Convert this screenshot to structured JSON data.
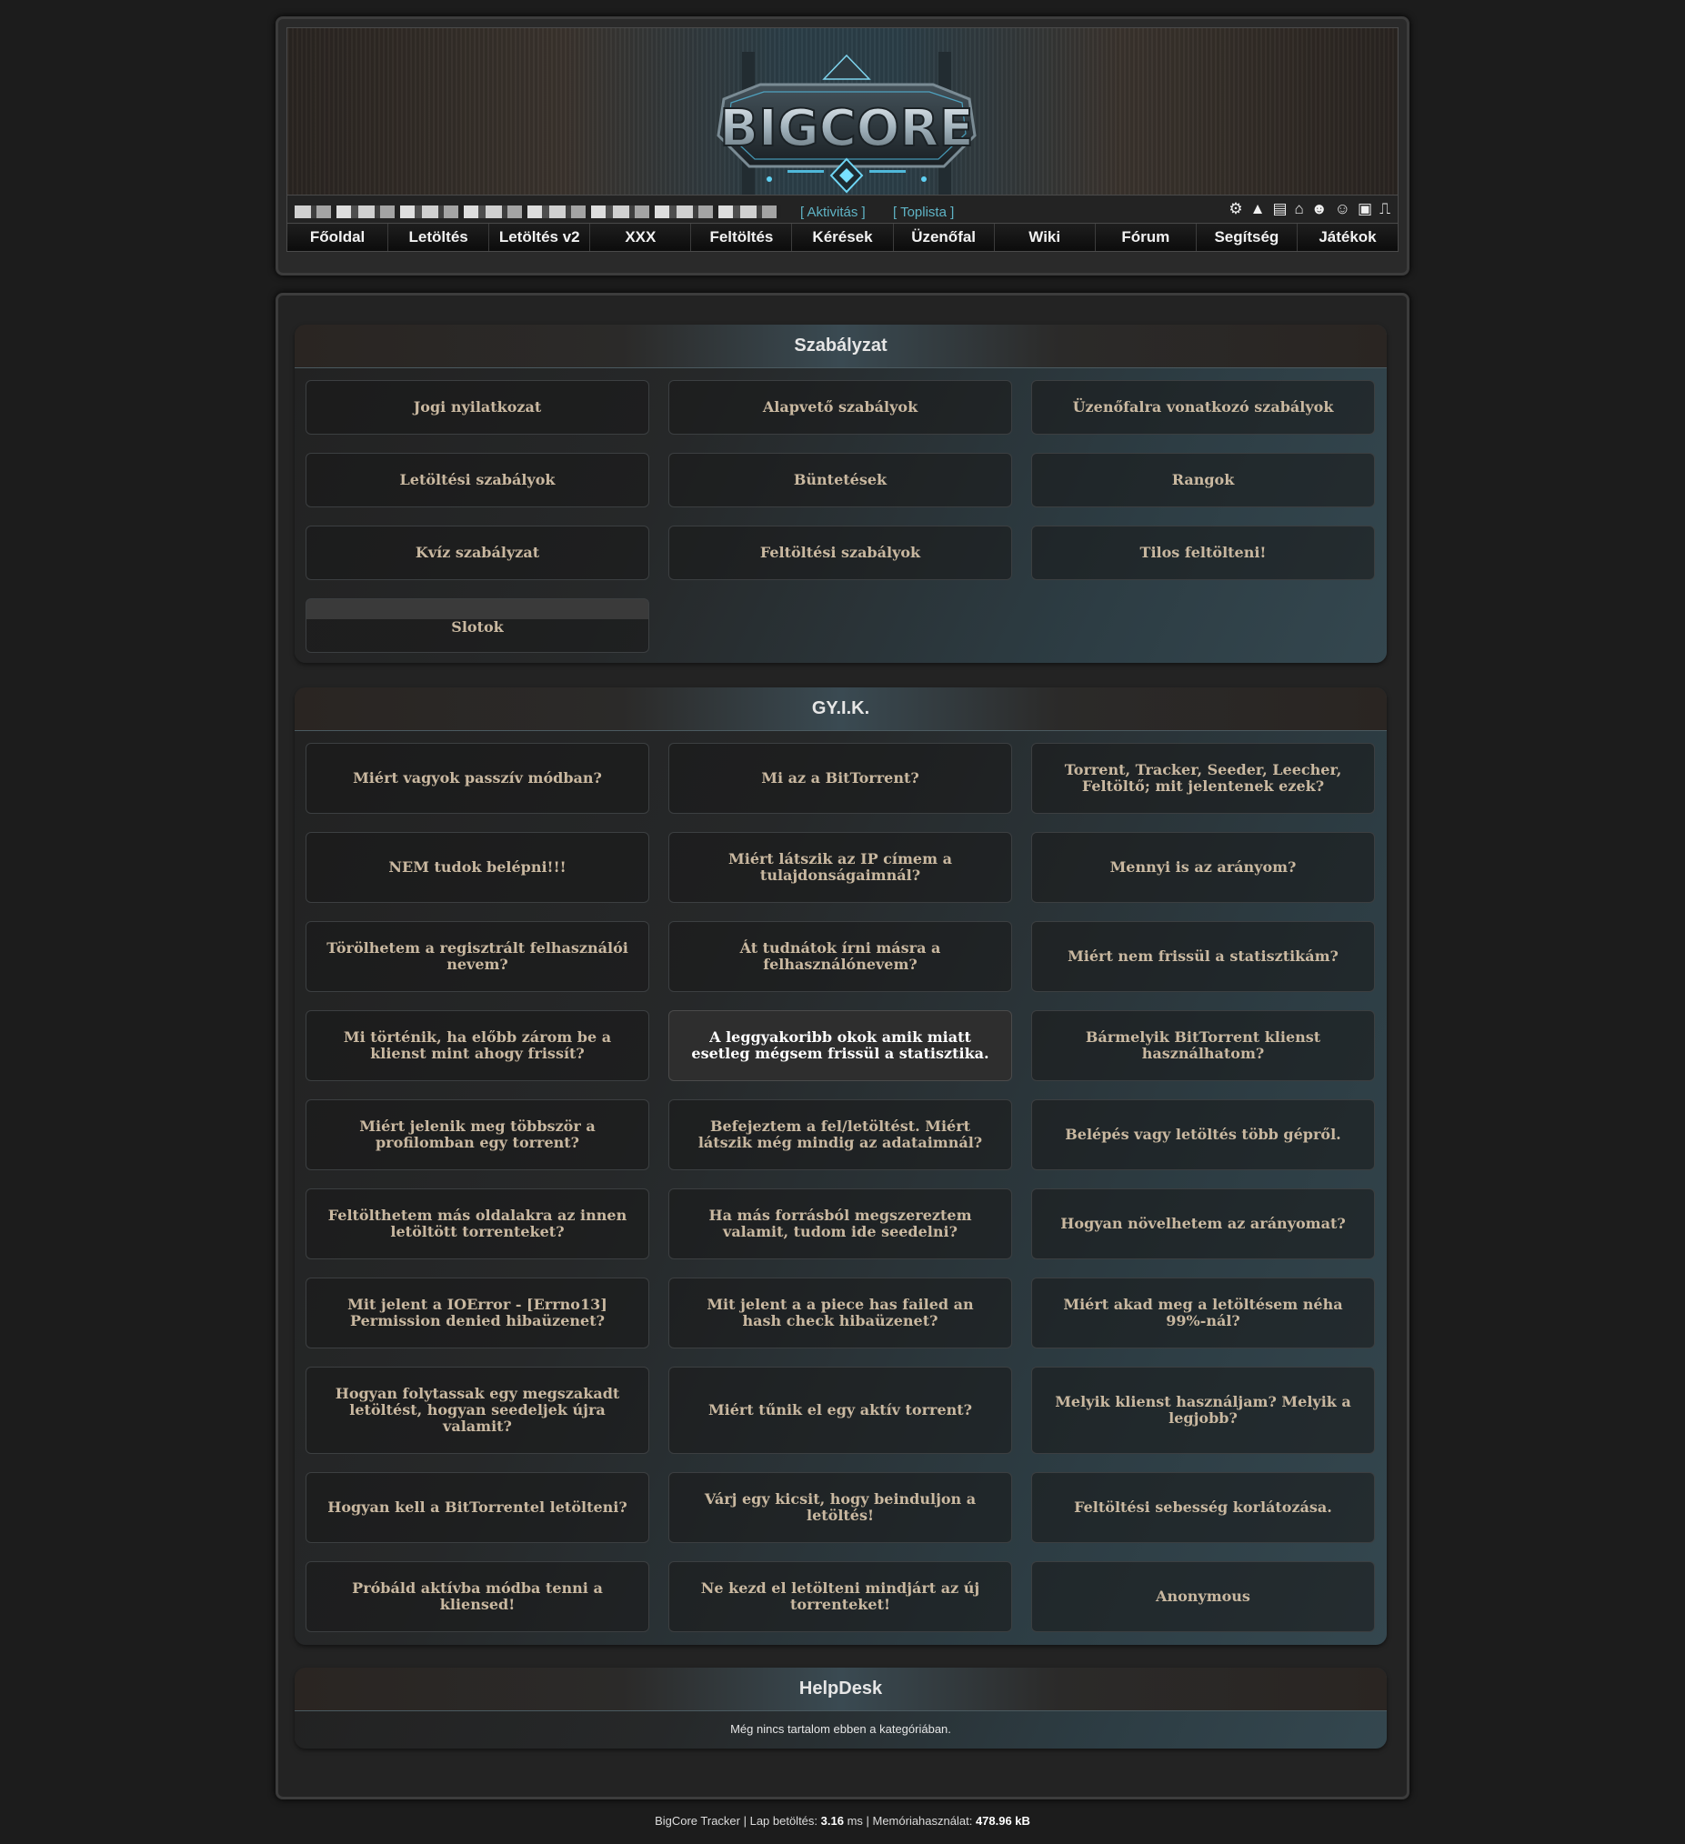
{
  "brand": {
    "logo_text": "BIGCORE"
  },
  "userbar": {
    "links": [
      "[ Aktivitás ]",
      "[ Toplista ]"
    ],
    "icons": [
      "gear-icon",
      "warning-icon",
      "id-card-icon",
      "inbox-icon",
      "users-icon",
      "friends-icon",
      "gallery-icon",
      "logout-icon"
    ]
  },
  "nav": [
    "Főoldal",
    "Letöltés",
    "Letöltés v2",
    "XXX",
    "Feltöltés",
    "Kérések",
    "Üzenőfal",
    "Wiki",
    "Fórum",
    "Segítség",
    "Játékok"
  ],
  "rules": {
    "title": "Szabályzat",
    "items": [
      "Jogi nyilatkozat",
      "Alapvető szabályok",
      "Üzenőfalra vonatkozó szabályok",
      "Letöltési szabályok",
      "Büntetések",
      "Rangok",
      "Kvíz szabályzat",
      "Feltöltési szabályok",
      "Tilos feltölteni!",
      "Slotok"
    ]
  },
  "faq": {
    "title": "GY.I.K.",
    "items": [
      "Miért vagyok passzív módban?",
      "Mi az a BitTorrent?",
      "Torrent, Tracker, Seeder, Leecher, Feltöltő; mit jelentenek ezek?",
      "NEM tudok belépni!!!",
      "Miért látszik az IP címem a tulajdonságaimnál?",
      "Mennyi is az arányom?",
      "Törölhetem a regisztrált felhasználói nevem?",
      "Át tudnátok írni másra a felhasználónevem?",
      "Miért nem frissül a statisztikám?",
      "Mi történik, ha előbb zárom be a klienst mint ahogy frissít?",
      "A leggyakoribb okok amik miatt esetleg mégsem frissül a statisztika.",
      "Bármelyik BitTorrent klienst használhatom?",
      "Miért jelenik meg többször a profilomban egy torrent?",
      "Befejeztem a fel/letöltést. Miért látszik még mindig az adataimnál?",
      "Belépés vagy letöltés több gépről.",
      "Feltölthetem más oldalakra az innen letöltött torrenteket?",
      "Ha más forrásból megszereztem valamit, tudom ide seedelni?",
      "Hogyan növelhetem az arányomat?",
      "Mit jelent a IOError - [Errno13] Permission denied hibaüzenet?",
      "Mit jelent a a piece has failed an hash check hibaüzenet?",
      "Miért akad meg a letöltésem néha 99%-nál?",
      "Hogyan folytassak egy megszakadt letöltést, hogyan seedeljek újra valamit?",
      "Miért tűnik el egy aktív torrent?",
      "Melyik klienst használjam? Melyik a legjobb?",
      "Hogyan kell a BitTorrentel letölteni?",
      "Várj egy kicsit, hogy beinduljon a letöltés!",
      "Feltöltési sebesség korlátozása.",
      "Próbáld aktívba módba tenni a kliensed!",
      "Ne kezd el letölteni mindjárt az új torrenteket!",
      "Anonymous"
    ],
    "active_index": 10
  },
  "helpdesk": {
    "title": "HelpDesk",
    "empty_text": "Még nincs tartalom ebben a kategóriában."
  },
  "footer": {
    "prefix": "BigCore Tracker | Lap betöltés: ",
    "load_time": "3.16",
    "mid": " ms | Memóriahasználat: ",
    "memory": "478.96 kB"
  }
}
